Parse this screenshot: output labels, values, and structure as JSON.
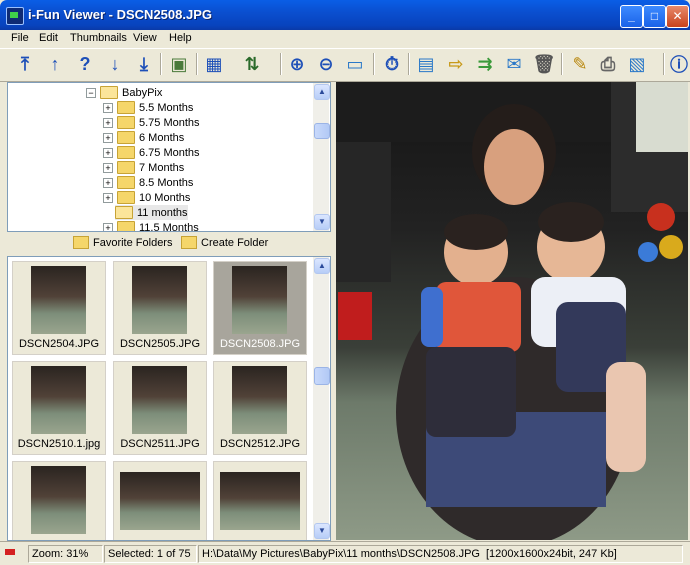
{
  "window": {
    "title": "i-Fun Viewer - DSCN2508.JPG"
  },
  "menu": [
    "File",
    "Edit",
    "Thumbnails",
    "View",
    "Help"
  ],
  "tree": {
    "root": "BabyPix",
    "items": [
      "5.5 Months",
      "5.75 Months",
      "6 Months",
      "6.75 Months",
      "7 Months",
      "8.5 Months",
      "10 Months",
      "11 months",
      "11.5 Months"
    ]
  },
  "folder_bar": {
    "favorite": "Favorite Folders",
    "create": "Create Folder"
  },
  "thumbnails": [
    "DSCN2504.JPG",
    "DSCN2505.JPG",
    "DSCN2508.JPG",
    "DSCN2510.1.jpg",
    "DSCN2511.JPG",
    "DSCN2512.JPG",
    "",
    "",
    ""
  ],
  "selected_thumbnail": "DSCN2508.JPG",
  "status": {
    "zoom": "Zoom: 31%",
    "selected": "Selected: 1 of 75",
    "path": "H:\\Data\\My Pictures\\BabyPix\\11 months\\DSCN2508.JPG",
    "info": "[1200x1600x24bit, 247 Kb]"
  },
  "icons": {
    "window_controls": [
      "minimize-icon",
      "maximize-icon",
      "close-icon"
    ],
    "toolbar": [
      "first-image-icon",
      "previous-image-icon",
      "help-icon",
      "next-image-icon",
      "last-image-icon",
      "slideshow-icon",
      "view-mode-icon",
      "sort-icon",
      "zoom-in-icon",
      "zoom-out-icon",
      "fit-window-icon",
      "timer-icon",
      "full-screen-icon",
      "move-icon",
      "copy-icon",
      "email-icon",
      "delete-icon",
      "edit-icon",
      "print-icon",
      "wallpaper-icon",
      "about-icon"
    ]
  }
}
